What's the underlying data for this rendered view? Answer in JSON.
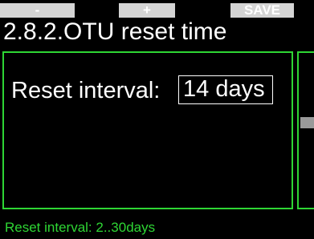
{
  "softkeys": {
    "left_label": "-",
    "center_label": "+",
    "right_label": "SAVE"
  },
  "header": {
    "title": "2.8.2.OTU reset time"
  },
  "setting": {
    "label": "Reset interval:",
    "value": "14 days"
  },
  "footer": {
    "hint": "Reset interval: 2..30days"
  },
  "colors": {
    "accent_green": "#2ed634",
    "softkey_gray": "#d4d4d4",
    "background": "#000000",
    "text": "#ffffff"
  }
}
